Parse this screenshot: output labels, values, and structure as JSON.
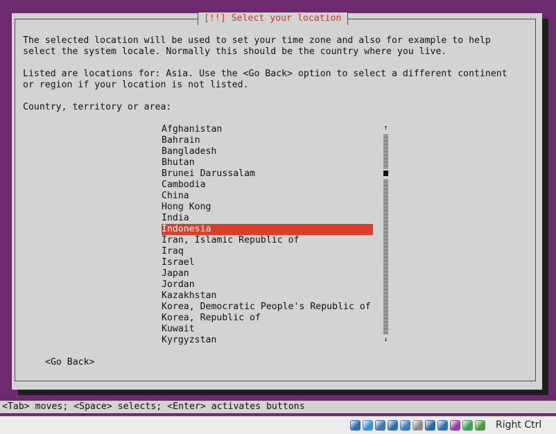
{
  "dialog": {
    "title": "[!!] Select your location",
    "paragraph1": "The selected location will be used to set your time zone and also for example to help\nselect the system locale. Normally this should be the country where you live.",
    "paragraph2": "Listed are locations for: Asia. Use the <Go Back> option to select a different continent\nor region if your location is not listed.",
    "prompt": "Country, territory or area:",
    "countries": [
      "Afghanistan",
      "Bahrain",
      "Bangladesh",
      "Bhutan",
      "Brunei Darussalam",
      "Cambodia",
      "China",
      "Hong Kong",
      "India",
      "Indonesia",
      "Iran, Islamic Republic of",
      "Iraq",
      "Israel",
      "Japan",
      "Jordan",
      "Kazakhstan",
      "Korea, Democratic People's Republic of",
      "Korea, Republic of",
      "Kuwait",
      "Kyrgyzstan"
    ],
    "selected_country": "Indonesia",
    "go_back_label": "<Go Back>",
    "scroll_up_glyph": "↑",
    "scroll_down_glyph": "↓"
  },
  "statusbar": {
    "text": "<Tab> moves; <Space> selects; <Enter> activates buttons"
  },
  "vbox": {
    "host_key": "Right Ctrl",
    "status_icons": [
      {
        "name": "hard-disk-icon",
        "color": "#2b6cb8"
      },
      {
        "name": "optical-drive-icon",
        "color": "#3a8fd8"
      },
      {
        "name": "audio-icon",
        "color": "#3c74b4"
      },
      {
        "name": "network-icon",
        "color": "#2f6db0"
      },
      {
        "name": "usb-icon",
        "color": "#3b7dc4"
      },
      {
        "name": "shared-folders-icon",
        "color": "#8a8a8a"
      },
      {
        "name": "display-icon",
        "color": "#2a66a8"
      },
      {
        "name": "video-capture-icon",
        "color": "#2f70b3"
      },
      {
        "name": "vbox-extension-icon",
        "color": "#8d3fb0"
      },
      {
        "name": "mouse-integration-icon",
        "color": "#3aa05a"
      },
      {
        "name": "keyboard-capture-icon",
        "color": "#4a9a3a"
      }
    ]
  },
  "colors": {
    "desktop": "#6e2a6f",
    "dialog_bg": "#d3d3d3",
    "title_text": "#c8362a",
    "selection_bg": "#d83f2b",
    "selection_text": "#ffffff"
  }
}
